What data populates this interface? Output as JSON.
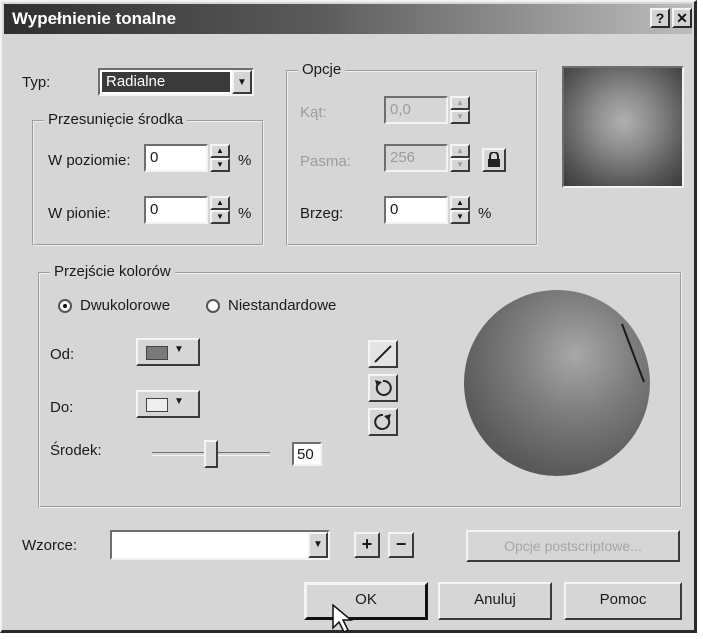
{
  "window": {
    "title": "Wypełnienie tonalne",
    "help_glyph": "?",
    "close_glyph": "✕"
  },
  "type_row": {
    "label": "Typ:",
    "value": "Radialne"
  },
  "center_offset": {
    "title": "Przesunięcie środka",
    "horizontal_label": "W poziomie:",
    "horizontal_value": "0",
    "vertical_label": "W pionie:",
    "vertical_value": "0",
    "unit": "%"
  },
  "options": {
    "title": "Opcje",
    "angle_label": "Kąt:",
    "angle_value": "0,0",
    "steps_label": "Pasma:",
    "steps_value": "256",
    "edge_label": "Brzeg:",
    "edge_value": "0",
    "unit": "%"
  },
  "color_blend": {
    "title": "Przejście kolorów",
    "two_color_label": "Dwukolorowe",
    "custom_label": "Niestandardowe",
    "selected_mode": "two_color",
    "from_label": "Od:",
    "to_label": "Do:",
    "midpoint_label": "Środek:",
    "midpoint_value": "50",
    "midpoint_level": 0.5,
    "from_color": "#7a7a7a",
    "to_color": "#eeeeee"
  },
  "presets": {
    "label": "Wzorce:",
    "value": "",
    "add_glyph": "+",
    "remove_glyph": "−",
    "postscript_label": "Opcje postscriptowe..."
  },
  "buttons": {
    "ok": "OK",
    "cancel": "Anuluj",
    "help": "Pomoc"
  }
}
